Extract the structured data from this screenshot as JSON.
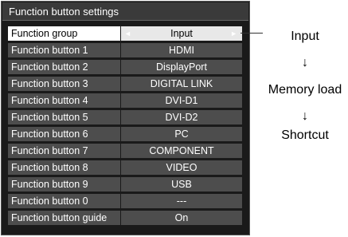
{
  "title": "Function button settings",
  "rows": [
    {
      "label": "Function group",
      "value": "Input",
      "left_arrow": "◄",
      "right_arrow": "►"
    },
    {
      "label": "Function button 1",
      "value": "HDMI"
    },
    {
      "label": "Function button 2",
      "value": "DisplayPort"
    },
    {
      "label": "Function button 3",
      "value": "DIGITAL LINK"
    },
    {
      "label": "Function button 4",
      "value": "DVI-D1"
    },
    {
      "label": "Function button 5",
      "value": "DVI-D2"
    },
    {
      "label": "Function button 6",
      "value": "PC"
    },
    {
      "label": "Function button 7",
      "value": "COMPONENT"
    },
    {
      "label": "Function button 8",
      "value": "VIDEO"
    },
    {
      "label": "Function button 9",
      "value": "USB"
    },
    {
      "label": "Function button 0",
      "value": "---"
    },
    {
      "label": "Function button guide",
      "value": "On"
    }
  ],
  "options": {
    "items": [
      "Input",
      "Memory load",
      "Shortcut"
    ],
    "arrow": "↓"
  },
  "colors": {
    "panel": "#1a1a1a",
    "row": "#4d4d4d",
    "selected": "#ffffff",
    "text": "#ffffff"
  }
}
